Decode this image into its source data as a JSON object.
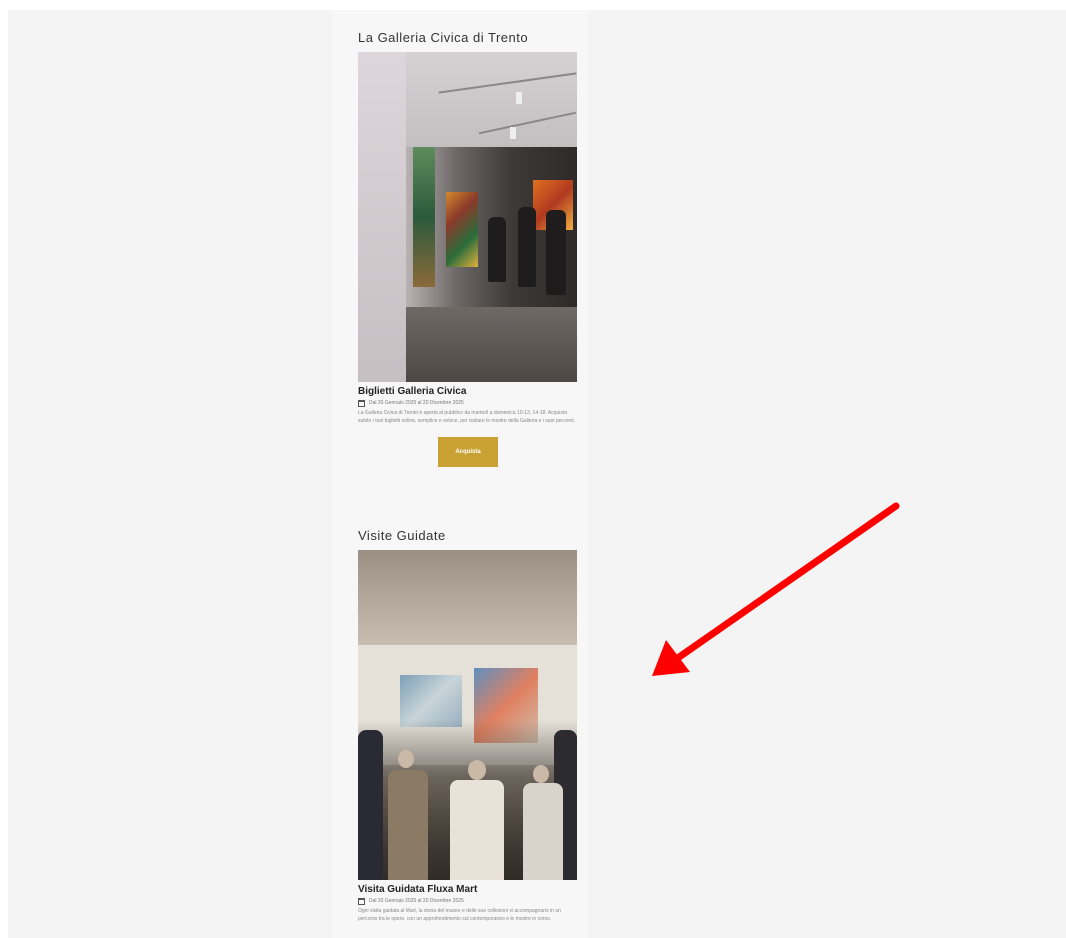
{
  "section_1": {
    "title": "La Galleria Civica di Trento",
    "item_title": "Biglietti Galleria Civica",
    "date": "Dal 20 Gennaio 2025 al 20 Dicembre 2025",
    "description": "La Galleria Civica di Trento è aperta al pubblico da martedì a domenica 10-13, 14-18. Acquista subito i tuoi biglietti online, semplice e veloce, per visitare le mostre della Galleria e i suoi percorsi.",
    "button_label": "Acquista"
  },
  "section_2": {
    "title": "Visite Guidate",
    "item_title": "Visita Guidata Fluxa Mart",
    "date": "Dal 20 Gennaio 2025 al 20 Dicembre 2025",
    "description": "Ogni visita guidata al Mart, la storia del museo e delle sue collezioni vi accompagnano in un percorso tra le opere, con un approfondimento sul contemporaneo e le mostre in corso."
  },
  "colors": {
    "accent": "#c9a233",
    "annotation_arrow": "#ff0000",
    "background": "#f4f4f4"
  }
}
